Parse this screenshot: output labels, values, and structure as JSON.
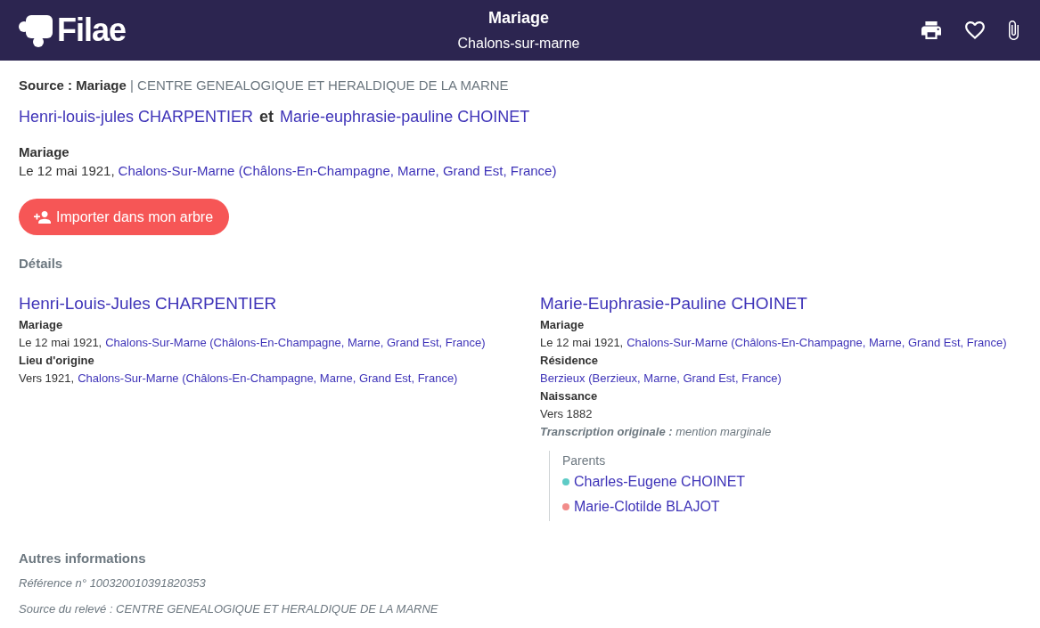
{
  "header": {
    "logo": "Filae",
    "title": "Mariage",
    "subtitle": "Chalons-sur-marne"
  },
  "source": "**Source : Mariage** | CENTRE GENEALOGIQUE ET HERALDIQUE DE LA MARNE",
  "couple": {
    "spouses": [
      "Henri-louis-jules CHARPENTIER",
      "Marie-euphrasie-pauline CHOINET"
    ],
    "conjunction": "et"
  },
  "event": {
    "label": "Mariage",
    "date": "Le 12 mai 1921,",
    "place": "Chalons-Sur-Marne (Châlons-En-Champagne, Marne, Grand Est, France)"
  },
  "import_button": "Importer dans mon arbre",
  "details": {
    "heading": "Détails",
    "persons": [
      {
        "name": "Henri-Louis-Jules CHARPENTIER",
        "facts": [
          {
            "label": "Mariage",
            "date": "Le 12 mai 1921,",
            "place": "Chalons-Sur-Marne (Châlons-En-Champagne, Marne, Grand Est, France)"
          },
          {
            "label": "Lieu d'origine",
            "date": "Vers 1921,",
            "place": "Chalons-Sur-Marne (Châlons-En-Champagne, Marne, Grand Est, France)"
          }
        ]
      },
      {
        "name": "Marie-Euphrasie-Pauline CHOINET",
        "facts": [
          {
            "label": "Mariage",
            "date": "Le 12 mai 1921,",
            "place": "Chalons-Sur-Marne (Châlons-En-Champagne, Marne, Grand Est, France)"
          },
          {
            "label": "Résidence",
            "place": "Berzieux (Berzieux, Marne, Grand Est, France)"
          },
          {
            "label": "Naissance",
            "date": "Vers 1882"
          }
        ],
        "transcription": "**Transcription originale :** mention marginale",
        "parents": {
          "title": "Parents",
          "items": [
            {
              "name": "Charles-Eugene CHOINET",
              "color": "#5ecbc6"
            },
            {
              "name": "Marie-Clotilde BLAJOT",
              "color": "#f28c8a"
            }
          ]
        }
      }
    ]
  },
  "other_info": {
    "heading": "Autres informations",
    "lines": [
      "Référence n° 100320010391820353",
      "Source du relevé : CENTRE GENEALOGIQUE ET HERALDIQUE DE LA MARNE"
    ]
  }
}
